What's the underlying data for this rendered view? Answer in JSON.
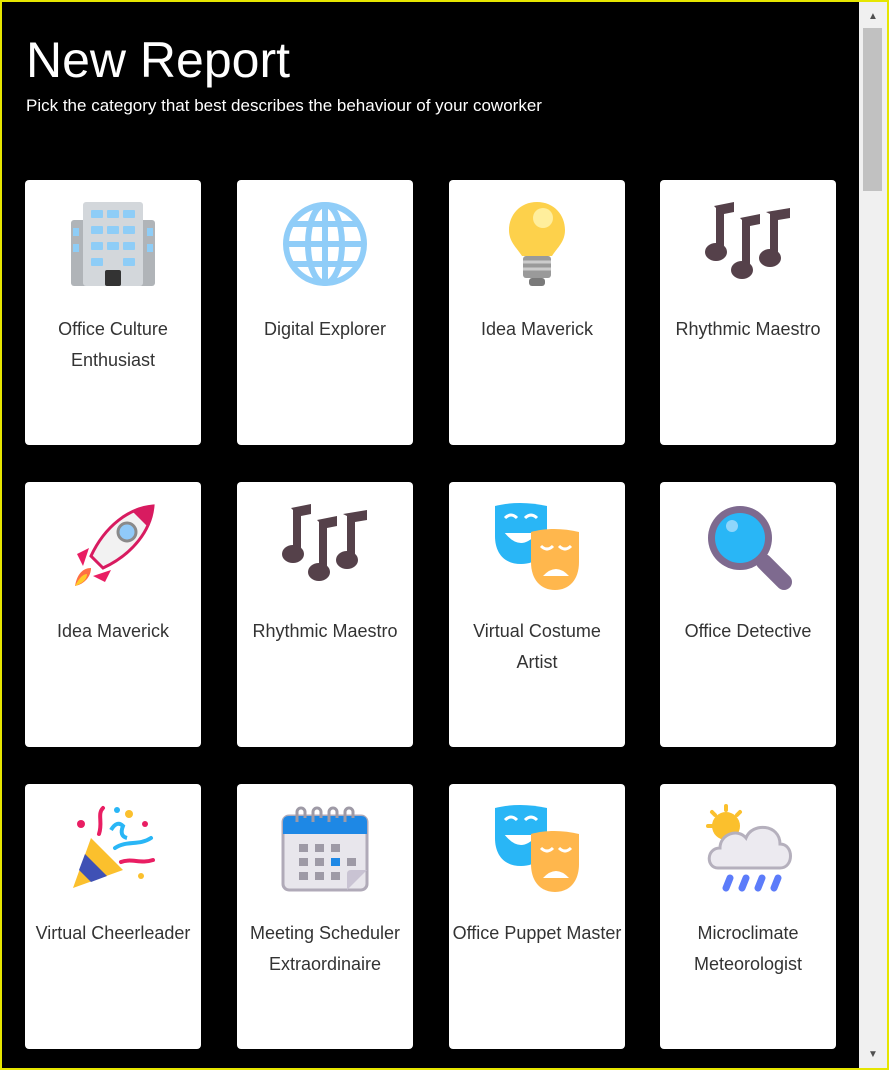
{
  "header": {
    "title": "New Report",
    "subtitle": "Pick the category that best describes the behaviour of your coworker"
  },
  "cards": [
    {
      "label": "Office Culture Enthusiast",
      "icon": "office-building-icon"
    },
    {
      "label": "Digital Explorer",
      "icon": "globe-icon"
    },
    {
      "label": "Idea Maverick",
      "icon": "light-bulb-icon"
    },
    {
      "label": "Rhythmic Maestro",
      "icon": "music-notes-icon"
    },
    {
      "label": "Idea Maverick",
      "icon": "rocket-icon"
    },
    {
      "label": "Rhythmic Maestro",
      "icon": "music-notes-icon"
    },
    {
      "label": "Virtual Costume Artist",
      "icon": "theater-masks-icon"
    },
    {
      "label": "Office Detective",
      "icon": "magnifying-glass-icon"
    },
    {
      "label": "Virtual Cheerleader",
      "icon": "party-popper-icon"
    },
    {
      "label": "Meeting Scheduler Extraordinaire",
      "icon": "calendar-icon"
    },
    {
      "label": "Office Puppet Master",
      "icon": "theater-masks-icon"
    },
    {
      "label": "Microclimate Meteorologist",
      "icon": "rain-cloud-icon"
    }
  ],
  "scrollbar": {
    "up_icon": "▲",
    "down_icon": "▼"
  },
  "colors": {
    "background": "#000000",
    "card": "#ffffff",
    "frame_border": "#e6e600",
    "label": "#333333"
  }
}
